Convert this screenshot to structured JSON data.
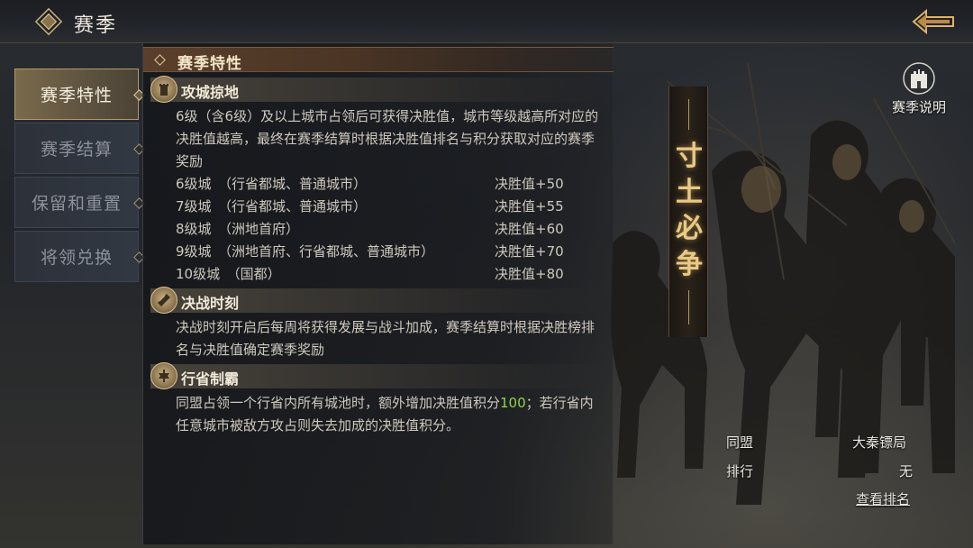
{
  "header": {
    "title": "赛季"
  },
  "tabs": [
    {
      "label": "赛季特性",
      "active": true
    },
    {
      "label": "赛季结算",
      "active": false
    },
    {
      "label": "保留和重置",
      "active": false
    },
    {
      "label": "将领兑换",
      "active": false
    }
  ],
  "panel": {
    "title": "赛季特性",
    "sections": {
      "conquest": {
        "title": "攻城掠地",
        "desc": "6级（含6级）及以上城市占领后可获得决胜值，城市等级越高所对应的决胜值越高，最终在赛季结算时根据决胜值排名与积分获取对应的赛季奖励",
        "cities": [
          {
            "name": "6级城　（行省都城、普通城市）",
            "value": "决胜值+50"
          },
          {
            "name": "7级城　（行省都城、普通城市）",
            "value": "决胜值+55"
          },
          {
            "name": "8级城　（洲地首府）",
            "value": "决胜值+60"
          },
          {
            "name": "9级城　（洲地首府、行省都城、普通城市）",
            "value": "决胜值+70"
          },
          {
            "name": "10级城　（国都）",
            "value": "决胜值+80"
          }
        ]
      },
      "decisive": {
        "title": "决战时刻",
        "desc": "决战时刻开启后每周将获得发展与战斗加成，赛季结算时根据决胜榜排名与决胜值确定赛季奖励"
      },
      "province": {
        "title": "行省制霸",
        "desc_before": "同盟占领一个行省内所有城池时，额外增加决胜值积分",
        "desc_highlight": "100",
        "desc_after": "；若行省内任意城市被敌方攻占则失去加成的决胜值积分。"
      }
    }
  },
  "banner": {
    "chars": [
      "寸",
      "土",
      "必",
      "争"
    ]
  },
  "season_info": {
    "label": "赛季说明"
  },
  "stats": {
    "alliance_label": "同盟",
    "alliance_value": "大秦镖局",
    "rank_label": "排行",
    "rank_value": "无",
    "view_rank_label": "查看排名"
  },
  "colors": {
    "accent": "#b49a62",
    "highlight": "#8fd44a",
    "banner_text": "#e8c985"
  }
}
